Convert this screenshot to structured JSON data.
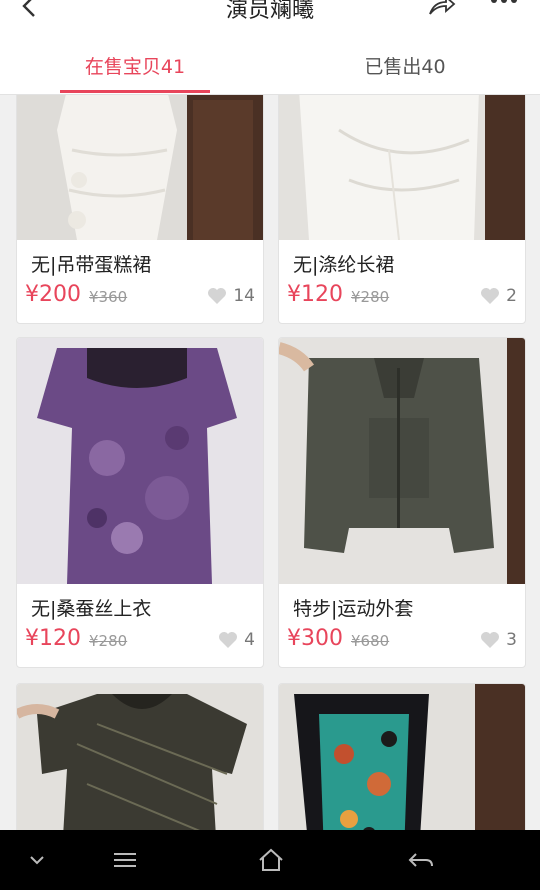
{
  "header": {
    "title": "演员斓曦",
    "back_icon": "back-arrow-icon",
    "share_icon": "share-icon",
    "more_icon": "more-dots-icon"
  },
  "tabs": {
    "selling": "在售宝贝41",
    "sold": "已售出40",
    "active": "selling",
    "accent_color": "#e8455b"
  },
  "products": [
    {
      "title": "无|吊带蛋糕裙",
      "price": "¥200",
      "original_price": "¥360",
      "likes": "14"
    },
    {
      "title": "无|涤纶长裙",
      "price": "¥120",
      "original_price": "¥280",
      "likes": "2"
    },
    {
      "title": "无|桑蚕丝上衣",
      "price": "¥120",
      "original_price": "¥280",
      "likes": "4"
    },
    {
      "title": "特步|运动外套",
      "price": "¥300",
      "original_price": "¥680",
      "likes": "3"
    },
    {
      "title": "",
      "price": "",
      "original_price": "",
      "likes": ""
    },
    {
      "title": "",
      "price": "",
      "original_price": "",
      "likes": ""
    }
  ],
  "navbar": {
    "icons": [
      "chevron-down-icon",
      "menu-icon",
      "home-icon",
      "back-icon"
    ]
  }
}
